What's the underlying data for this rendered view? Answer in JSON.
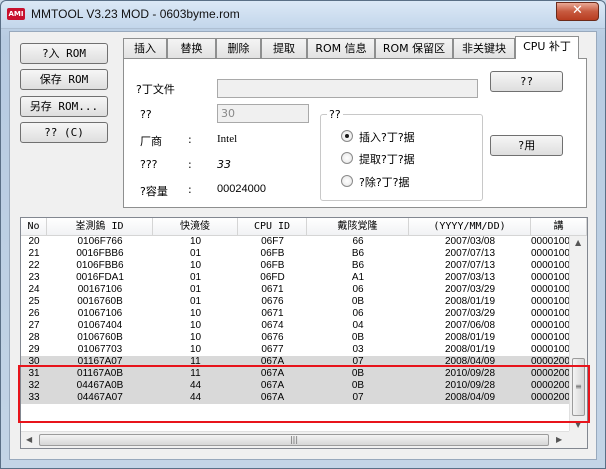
{
  "window": {
    "title": "MMTOOL V3.23 MOD - 0603byme.rom",
    "icon_text": "AMI",
    "close_label": "✕"
  },
  "left_buttons": [
    "?入 ROM",
    "保存 ROM",
    "另存 ROM...",
    "?? (C)"
  ],
  "tabs": [
    "插入",
    "替换",
    "删除",
    "提取",
    "ROM 信息",
    "ROM 保留区",
    "非关键块",
    "CPU 补丁"
  ],
  "active_tab": "CPU 补丁",
  "panel": {
    "file_label": "?丁文件",
    "file_value": "",
    "num_label": "??",
    "num_value": "30",
    "vendor_label": "厂商",
    "vendor_colon": ":",
    "vendor_value": "Intel",
    "q_label": "???",
    "q_colon": ":",
    "q_value": "33",
    "cap_label": "?容量",
    "cap_colon": ":",
    "cap_value": "00024000",
    "group_title": "??",
    "radios": [
      "插入?丁?据",
      "提取?丁?据",
      "?除?丁?据"
    ],
    "radio_checked": 0,
    "browse_button": "??",
    "apply_button": "?用"
  },
  "table": {
    "columns": [
      "No",
      "峑測鎢 ID",
      "快滰倰",
      "CPU ID",
      "戴陔覚隆",
      "(YYYY/MM/DD)",
      "講"
    ],
    "rows": [
      [
        "20",
        "0106F766",
        "10",
        "06F7",
        "66",
        "2007/03/08",
        "0000100"
      ],
      [
        "21",
        "0016FBB6",
        "01",
        "06FB",
        "B6",
        "2007/07/13",
        "0000100"
      ],
      [
        "22",
        "0106FBB6",
        "10",
        "06FB",
        "B6",
        "2007/07/13",
        "0000100"
      ],
      [
        "23",
        "0016FDA1",
        "01",
        "06FD",
        "A1",
        "2007/03/13",
        "0000100"
      ],
      [
        "24",
        "00167106",
        "01",
        "0671",
        "06",
        "2007/03/29",
        "0000100"
      ],
      [
        "25",
        "0016760B",
        "01",
        "0676",
        "0B",
        "2008/01/19",
        "0000100"
      ],
      [
        "26",
        "01067106",
        "10",
        "0671",
        "06",
        "2007/03/29",
        "0000100"
      ],
      [
        "27",
        "01067404",
        "10",
        "0674",
        "04",
        "2007/06/08",
        "0000100"
      ],
      [
        "28",
        "0106760B",
        "10",
        "0676",
        "0B",
        "2008/01/19",
        "0000100"
      ],
      [
        "29",
        "01067703",
        "10",
        "0677",
        "03",
        "2008/01/19",
        "0000100"
      ],
      [
        "30",
        "01167A07",
        "11",
        "067A",
        "07",
        "2008/04/09",
        "0000200"
      ],
      [
        "31",
        "01167A0B",
        "11",
        "067A",
        "0B",
        "2010/09/28",
        "0000200"
      ],
      [
        "32",
        "04467A0B",
        "44",
        "067A",
        "0B",
        "2010/09/28",
        "0000200"
      ],
      [
        "33",
        "04467A07",
        "44",
        "067A",
        "07",
        "2008/04/09",
        "0000200"
      ]
    ]
  }
}
